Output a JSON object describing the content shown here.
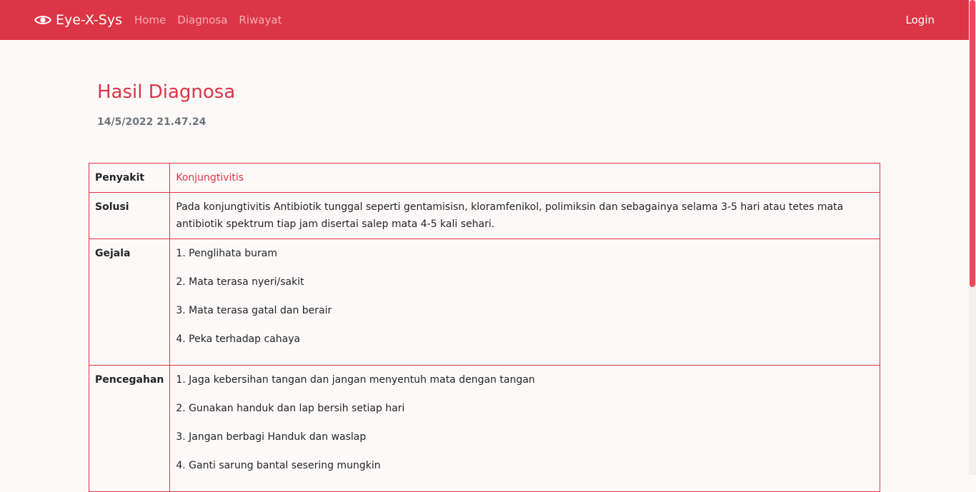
{
  "navbar": {
    "brand": "Eye-X-Sys",
    "brand_icon": "eye-icon",
    "links": [
      "Home",
      "Diagnosa",
      "Riwayat"
    ],
    "login": "Login",
    "color": "#dc3545"
  },
  "result": {
    "title": "Hasil Diagnosa",
    "timestamp": "14/5/2022 21.47.24",
    "penyakit_label": "Penyakit",
    "penyakit": "Konjungtivitis",
    "solusi_label": "Solusi",
    "solusi": "Pada konjungtivitis Antibiotik tunggal seperti gentamisisn, kloramfenikol, polimiksin dan sebagainya selama 3-5 hari atau tetes mata antibiotik spektrum tiap jam disertai salep mata 4-5 kali sehari.",
    "gejala_label": "Gejala",
    "gejala": [
      "1. Penglihata buram",
      "2. Mata terasa nyeri/sakit",
      "3. Mata terasa gatal dan berair",
      "4. Peka terhadap cahaya"
    ],
    "pencegahan_label": "Pencegahan",
    "pencegahan": [
      "1. Jaga kebersihan tangan dan jangan menyentuh mata dengan tangan",
      "2. Gunakan handuk dan lap bersih setiap hari",
      "3. Jangan berbagi Handuk dan waslap",
      "4. Ganti sarung bantal sesering mungkin"
    ]
  }
}
